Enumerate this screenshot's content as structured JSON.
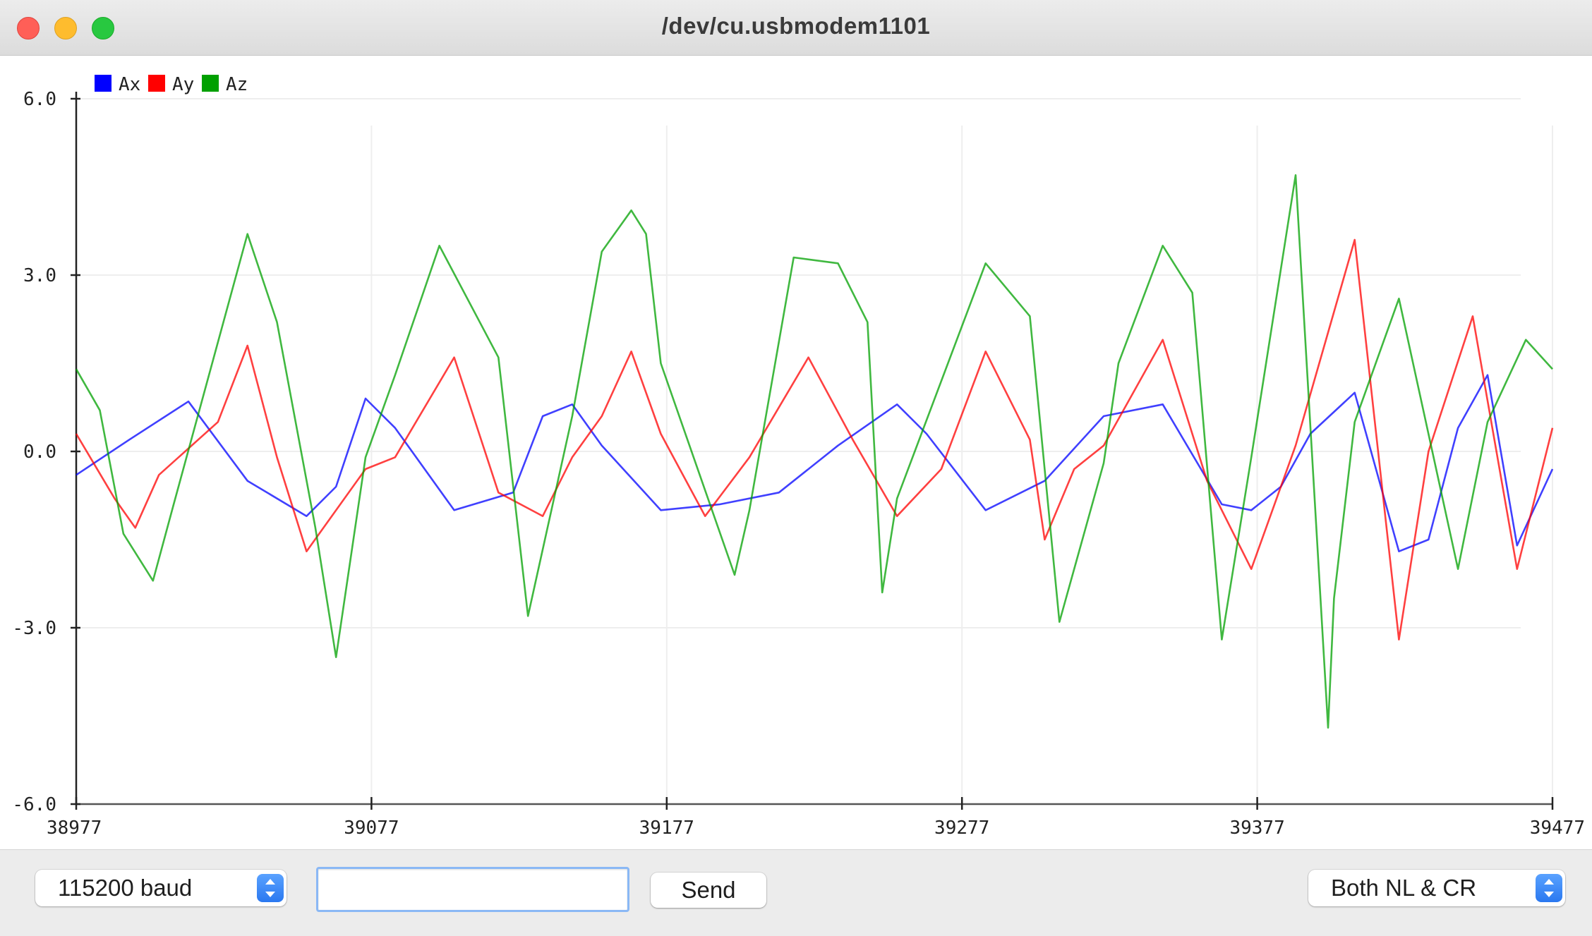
{
  "window": {
    "title": "/dev/cu.usbmodem1101"
  },
  "controls": {
    "baud": "115200 baud",
    "input_value": "",
    "send_label": "Send",
    "line_ending": "Both NL & CR"
  },
  "colors": {
    "Ax": "#0000ff",
    "Ay": "#ff0000",
    "Az": "#00a000",
    "grid": "#eeeeee",
    "axis": "#222222"
  },
  "chart_data": {
    "type": "line",
    "title": "",
    "xlabel": "",
    "ylabel": "",
    "xlim": [
      38977,
      39477
    ],
    "ylim": [
      -6.0,
      6.0
    ],
    "x_ticks": [
      "38977",
      "39077",
      "39177",
      "39277",
      "39377",
      "39477"
    ],
    "y_ticks": [
      "6.0",
      "3.0",
      "0.0",
      "-3.0",
      "-6.0"
    ],
    "grid": true,
    "legend_position": "top-left",
    "series": [
      {
        "name": "Ax",
        "x": [
          38977,
          38995,
          39015,
          39035,
          39055,
          39065,
          39075,
          39085,
          39105,
          39125,
          39135,
          39145,
          39155,
          39175,
          39195,
          39215,
          39235,
          39255,
          39265,
          39285,
          39305,
          39325,
          39345,
          39365,
          39375,
          39385,
          39395,
          39410,
          39425,
          39435,
          39445,
          39455,
          39465,
          39477
        ],
        "y": [
          -0.4,
          0.2,
          0.85,
          -0.5,
          -1.1,
          -0.6,
          0.9,
          0.4,
          -1.0,
          -0.7,
          0.6,
          0.8,
          0.1,
          -1.0,
          -0.9,
          -0.7,
          0.1,
          0.8,
          0.3,
          -1.0,
          -0.5,
          0.6,
          0.8,
          -0.9,
          -1.0,
          -0.6,
          0.3,
          1.0,
          -1.7,
          -1.5,
          0.4,
          1.3,
          -1.6,
          -0.3
        ]
      },
      {
        "name": "Ay",
        "x": [
          38977,
          38990,
          38997,
          39005,
          39025,
          39035,
          39045,
          39055,
          39075,
          39085,
          39105,
          39120,
          39135,
          39145,
          39155,
          39165,
          39175,
          39190,
          39205,
          39225,
          39240,
          39255,
          39270,
          39285,
          39300,
          39305,
          39315,
          39325,
          39345,
          39360,
          39375,
          39390,
          39410,
          39425,
          39435,
          39450,
          39465,
          39477
        ],
        "y": [
          0.3,
          -0.8,
          -1.3,
          -0.4,
          0.5,
          1.8,
          -0.1,
          -1.7,
          -0.3,
          -0.1,
          1.6,
          -0.7,
          -1.1,
          -0.1,
          0.6,
          1.7,
          0.3,
          -1.1,
          -0.1,
          1.6,
          0.2,
          -1.1,
          -0.3,
          1.7,
          0.2,
          -1.5,
          -0.3,
          0.1,
          1.9,
          -0.5,
          -2.0,
          0.1,
          3.6,
          -3.2,
          0.0,
          2.3,
          -2.0,
          0.4
        ]
      },
      {
        "name": "Az",
        "x": [
          38977,
          38985,
          38993,
          39003,
          39010,
          39035,
          39045,
          39058,
          39065,
          39075,
          39085,
          39100,
          39120,
          39130,
          39145,
          39155,
          39165,
          39170,
          39175,
          39200,
          39205,
          39220,
          39235,
          39245,
          39250,
          39255,
          39285,
          39300,
          39310,
          39325,
          39330,
          39345,
          39355,
          39365,
          39375,
          39390,
          39401,
          39403,
          39410,
          39425,
          39445,
          39455,
          39468,
          39477
        ],
        "y": [
          1.4,
          0.7,
          -1.4,
          -2.2,
          -0.9,
          3.7,
          2.2,
          -1.3,
          -3.5,
          -0.1,
          1.3,
          3.5,
          1.6,
          -2.8,
          0.6,
          3.4,
          4.1,
          3.7,
          1.5,
          -2.1,
          -1.0,
          3.3,
          3.2,
          2.2,
          -2.4,
          -0.8,
          3.2,
          2.3,
          -2.9,
          -0.2,
          1.5,
          3.5,
          2.7,
          -3.2,
          -0.1,
          4.7,
          -4.7,
          -2.5,
          0.5,
          2.6,
          -2.0,
          0.5,
          1.9,
          1.4
        ]
      }
    ]
  }
}
